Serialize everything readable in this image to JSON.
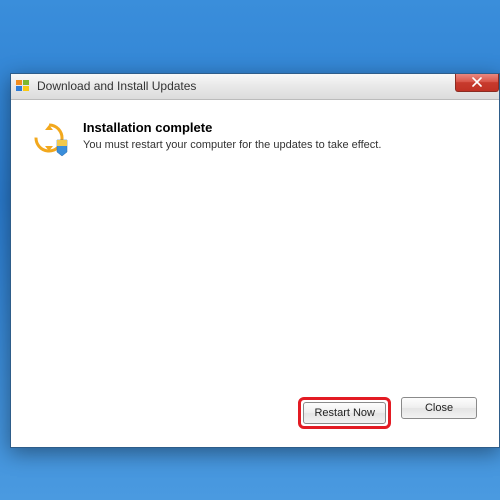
{
  "titlebar": {
    "title": "Download and Install Updates"
  },
  "content": {
    "heading": "Installation complete",
    "subtext": "You must restart your computer for the updates to take effect."
  },
  "buttons": {
    "restart": "Restart Now",
    "close": "Close"
  }
}
